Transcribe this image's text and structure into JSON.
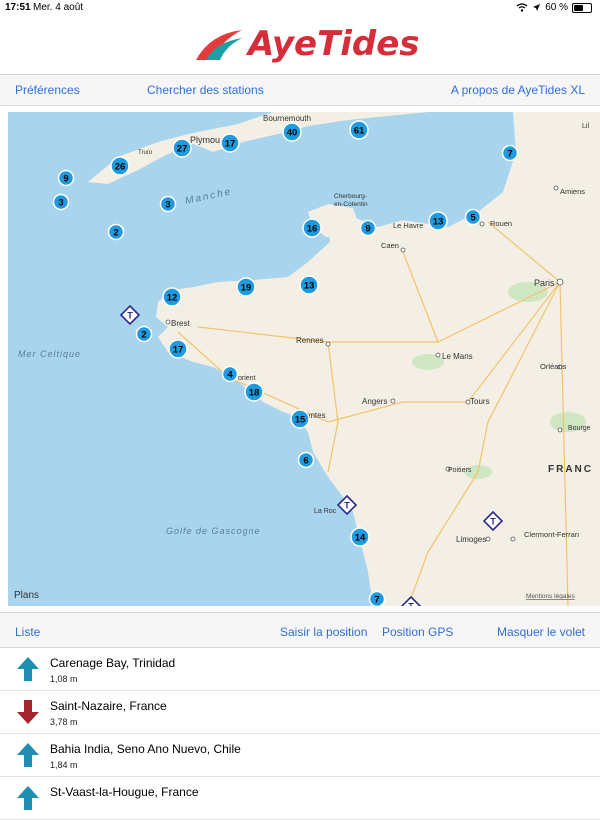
{
  "status_bar": {
    "time": "17:51",
    "date": "Mer. 4 août",
    "battery_text": "60 %",
    "battery_level": 0.6
  },
  "app": {
    "name": "AyeTides"
  },
  "top_nav": {
    "preferences": "Préférences",
    "search": "Chercher des stations",
    "about": "A propos de AyeTides XL"
  },
  "map": {
    "attribution": "Plans",
    "legal": "Mentions légales",
    "water_color": "#a9d4ee",
    "land_color": "#f4efe4",
    "marker_color": "#1e9be0",
    "labels": {
      "bournemouth": "Bournemouth",
      "plymouth": "Plymou",
      "truro": "Truro",
      "manche": "Manche",
      "cherbourg1": "Cherbourg-",
      "cherbourg2": "en-Cotentin",
      "le_havre": "Le Havre",
      "rouen": "Rouen",
      "amiens": "Amiens",
      "caen": "Caen",
      "paris": "Paris",
      "brest": "Brest",
      "mer_celtique": "Mer Celtique",
      "rennes": "Rennes",
      "le_mans": "Le Mans",
      "orleans": "Orléans",
      "lorient": "orient",
      "angers": "Angers",
      "tours": "Tours",
      "bourges": "Bourge",
      "nantes": "antes",
      "france": "FRANC",
      "poitiers": "Poitiers",
      "la_rochelle": "La Roc",
      "golfe": "Golfe de Gascogne",
      "limoges": "Limoges",
      "clermont": "Clermont-Ferran",
      "lille": "Lil"
    },
    "clusters": [
      "40",
      "61",
      "27",
      "17",
      "26",
      "9",
      "3",
      "3",
      "2",
      "7",
      "16",
      "9",
      "13",
      "5",
      "19",
      "13",
      "12",
      "2",
      "17",
      "4",
      "18",
      "15",
      "6",
      "14",
      "7"
    ],
    "tide_marker_label": "T"
  },
  "bottom_nav": {
    "list": "Liste",
    "enter_position": "Saisir la position",
    "gps": "Position GPS",
    "hide_panel": "Masquer le volet"
  },
  "stations": [
    {
      "name": "Carenage Bay, Trinidad",
      "value": "1,08 m",
      "trend": "rising"
    },
    {
      "name": "Saint-Nazaire, France",
      "value": "3,78 m",
      "trend": "falling"
    },
    {
      "name": "Bahia India, Seno Ano Nuevo, Chile",
      "value": "1,84 m",
      "trend": "rising"
    },
    {
      "name": "St-Vaast-la-Hougue, France",
      "value": "",
      "trend": "rising"
    }
  ],
  "colors": {
    "rising": "#1f8eb0",
    "falling": "#a5232c",
    "link": "#2f6fd6"
  }
}
